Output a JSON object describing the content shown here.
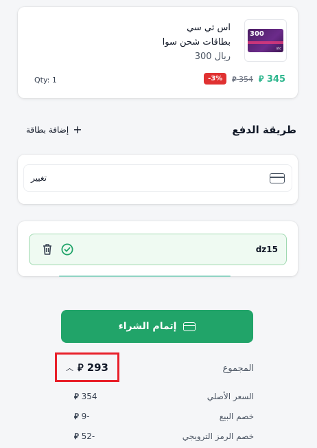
{
  "product": {
    "thumb_number": "300",
    "thumb_brand": "stc",
    "name": "اس تي سي",
    "category": "بطاقات شحن سوا",
    "denomination": "ريال 300",
    "discount_badge": "-3%",
    "old_price": "354",
    "new_price": "345",
    "currency_symbol": "⃁",
    "qty": "Qty: 1"
  },
  "payment": {
    "section_title": "طريقة الدفع",
    "add_card_label": "إضافة بطاقة",
    "change_label": "تغيير"
  },
  "promo": {
    "code": "dz15"
  },
  "checkout": {
    "button_label": "إتمام الشراء"
  },
  "summary": {
    "total_label": "المجموع",
    "total_value": "293",
    "rows": [
      {
        "label": "السعر الأصلي",
        "value": "354"
      },
      {
        "label": "خصم البيع",
        "value": "9-"
      },
      {
        "label": "خصم الرمز الترويجي",
        "value": "52-"
      }
    ]
  },
  "colors": {
    "accent_green": "#21a469",
    "price_teal": "#2bb58c",
    "discount_red": "#e03131",
    "highlight_red": "#e8202a"
  }
}
